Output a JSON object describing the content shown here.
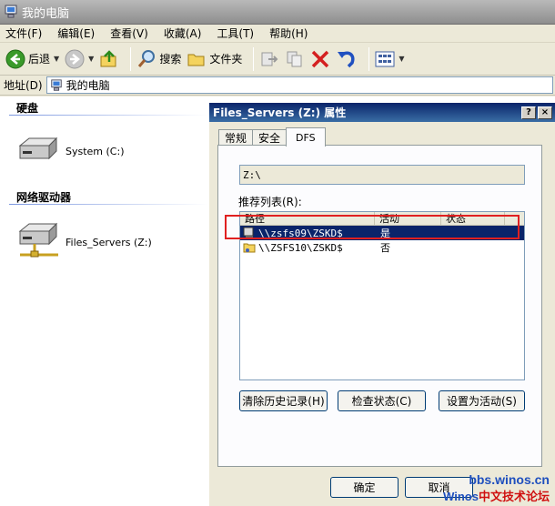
{
  "window": {
    "title": "我的电脑"
  },
  "menu": [
    "文件(F)",
    "编辑(E)",
    "查看(V)",
    "收藏(A)",
    "工具(T)",
    "帮助(H)"
  ],
  "toolbar": {
    "back": "后退",
    "search": "搜索",
    "folders": "文件夹"
  },
  "address": {
    "label": "地址(D)",
    "value": "我的电脑"
  },
  "explorer": {
    "hard_disks_title": "硬盘",
    "hard_disk": "System (C:)",
    "network_title": "网络驱动器",
    "network_drive": "Files_Servers (Z:)"
  },
  "dialog": {
    "title": "Files_Servers (Z:) 属性",
    "help_glyph": "?",
    "close_glyph": "×",
    "tabs": [
      "常规",
      "安全",
      "DFS"
    ],
    "path": "Z:\\",
    "list_label": "推荐列表(R):",
    "columns": [
      "路径",
      "活动",
      "状态"
    ],
    "rows": [
      {
        "path": "\\\\zsfs09\\ZSKD$",
        "active": "是",
        "status": ""
      },
      {
        "path": "\\\\ZSFS10\\ZSKD$",
        "active": "否",
        "status": ""
      }
    ],
    "buttons": {
      "clear_history": "清除历史记录(H)",
      "check_status": "检查状态(C)",
      "set_active": "设置为活动(S)"
    },
    "ok": "确定",
    "cancel": "取消"
  },
  "watermark": {
    "line1": "bbs.winos.cn",
    "line2_a": "Winos",
    "line2_b": "中文技术论坛"
  },
  "colors": {
    "selection": "#0a246a",
    "dialog_title": "#0a246a",
    "highlight": "#e02020"
  }
}
